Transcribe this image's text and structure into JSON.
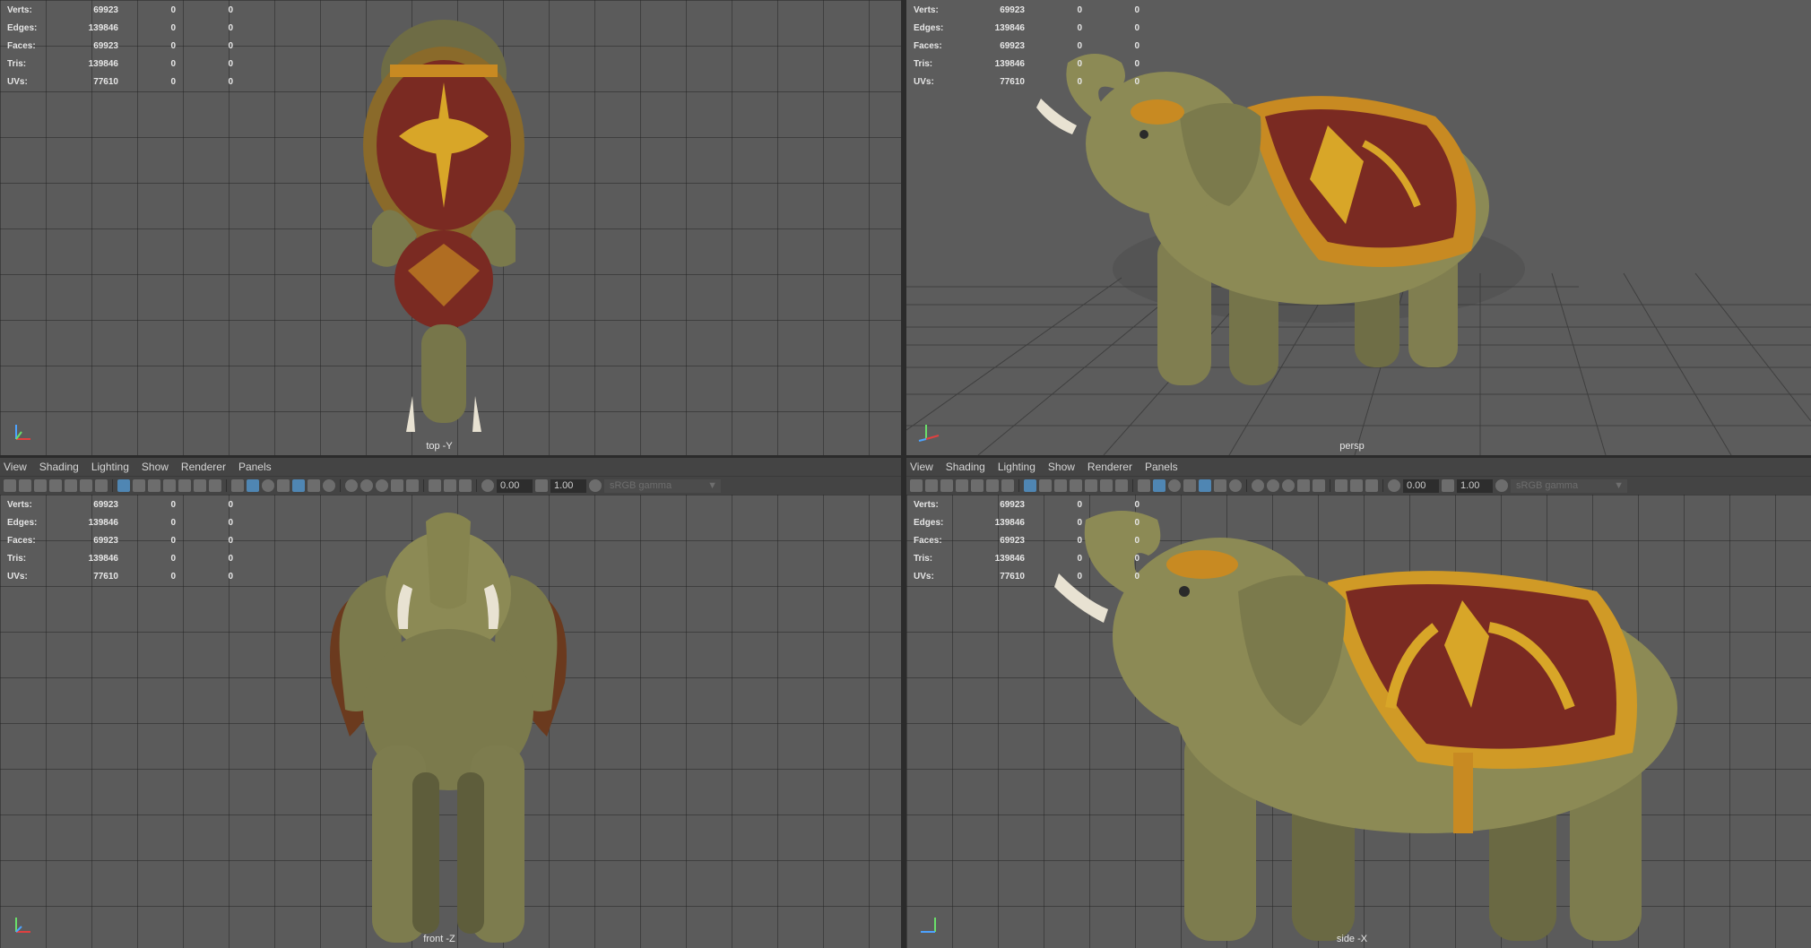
{
  "stats": {
    "rows": [
      {
        "label": "Verts:",
        "value": "69923",
        "a": "0",
        "b": "0"
      },
      {
        "label": "Edges:",
        "value": "139846",
        "a": "0",
        "b": "0"
      },
      {
        "label": "Faces:",
        "value": "69923",
        "a": "0",
        "b": "0"
      },
      {
        "label": "Tris:",
        "value": "139846",
        "a": "0",
        "b": "0"
      },
      {
        "label": "UVs:",
        "value": "77610",
        "a": "0",
        "b": "0"
      }
    ]
  },
  "viewports": {
    "top": {
      "camera": "top -Y"
    },
    "persp": {
      "camera": "persp"
    },
    "front": {
      "camera": "front -Z"
    },
    "side": {
      "camera": "side -X"
    }
  },
  "menubar": {
    "items": [
      "View",
      "Shading",
      "Lighting",
      "Show",
      "Renderer",
      "Panels"
    ]
  },
  "toolbar": {
    "exposure": "0.00",
    "gamma": "1.00",
    "color_space": "sRGB gamma",
    "dropdown_arrow": "▼"
  },
  "colors": {
    "viewport_bg": "#5b5b5b",
    "accent": "#4f86b3",
    "elephant_skin": "#8c8a55",
    "blanket_red": "#7a2a22",
    "blanket_gold": "#d8a628"
  }
}
